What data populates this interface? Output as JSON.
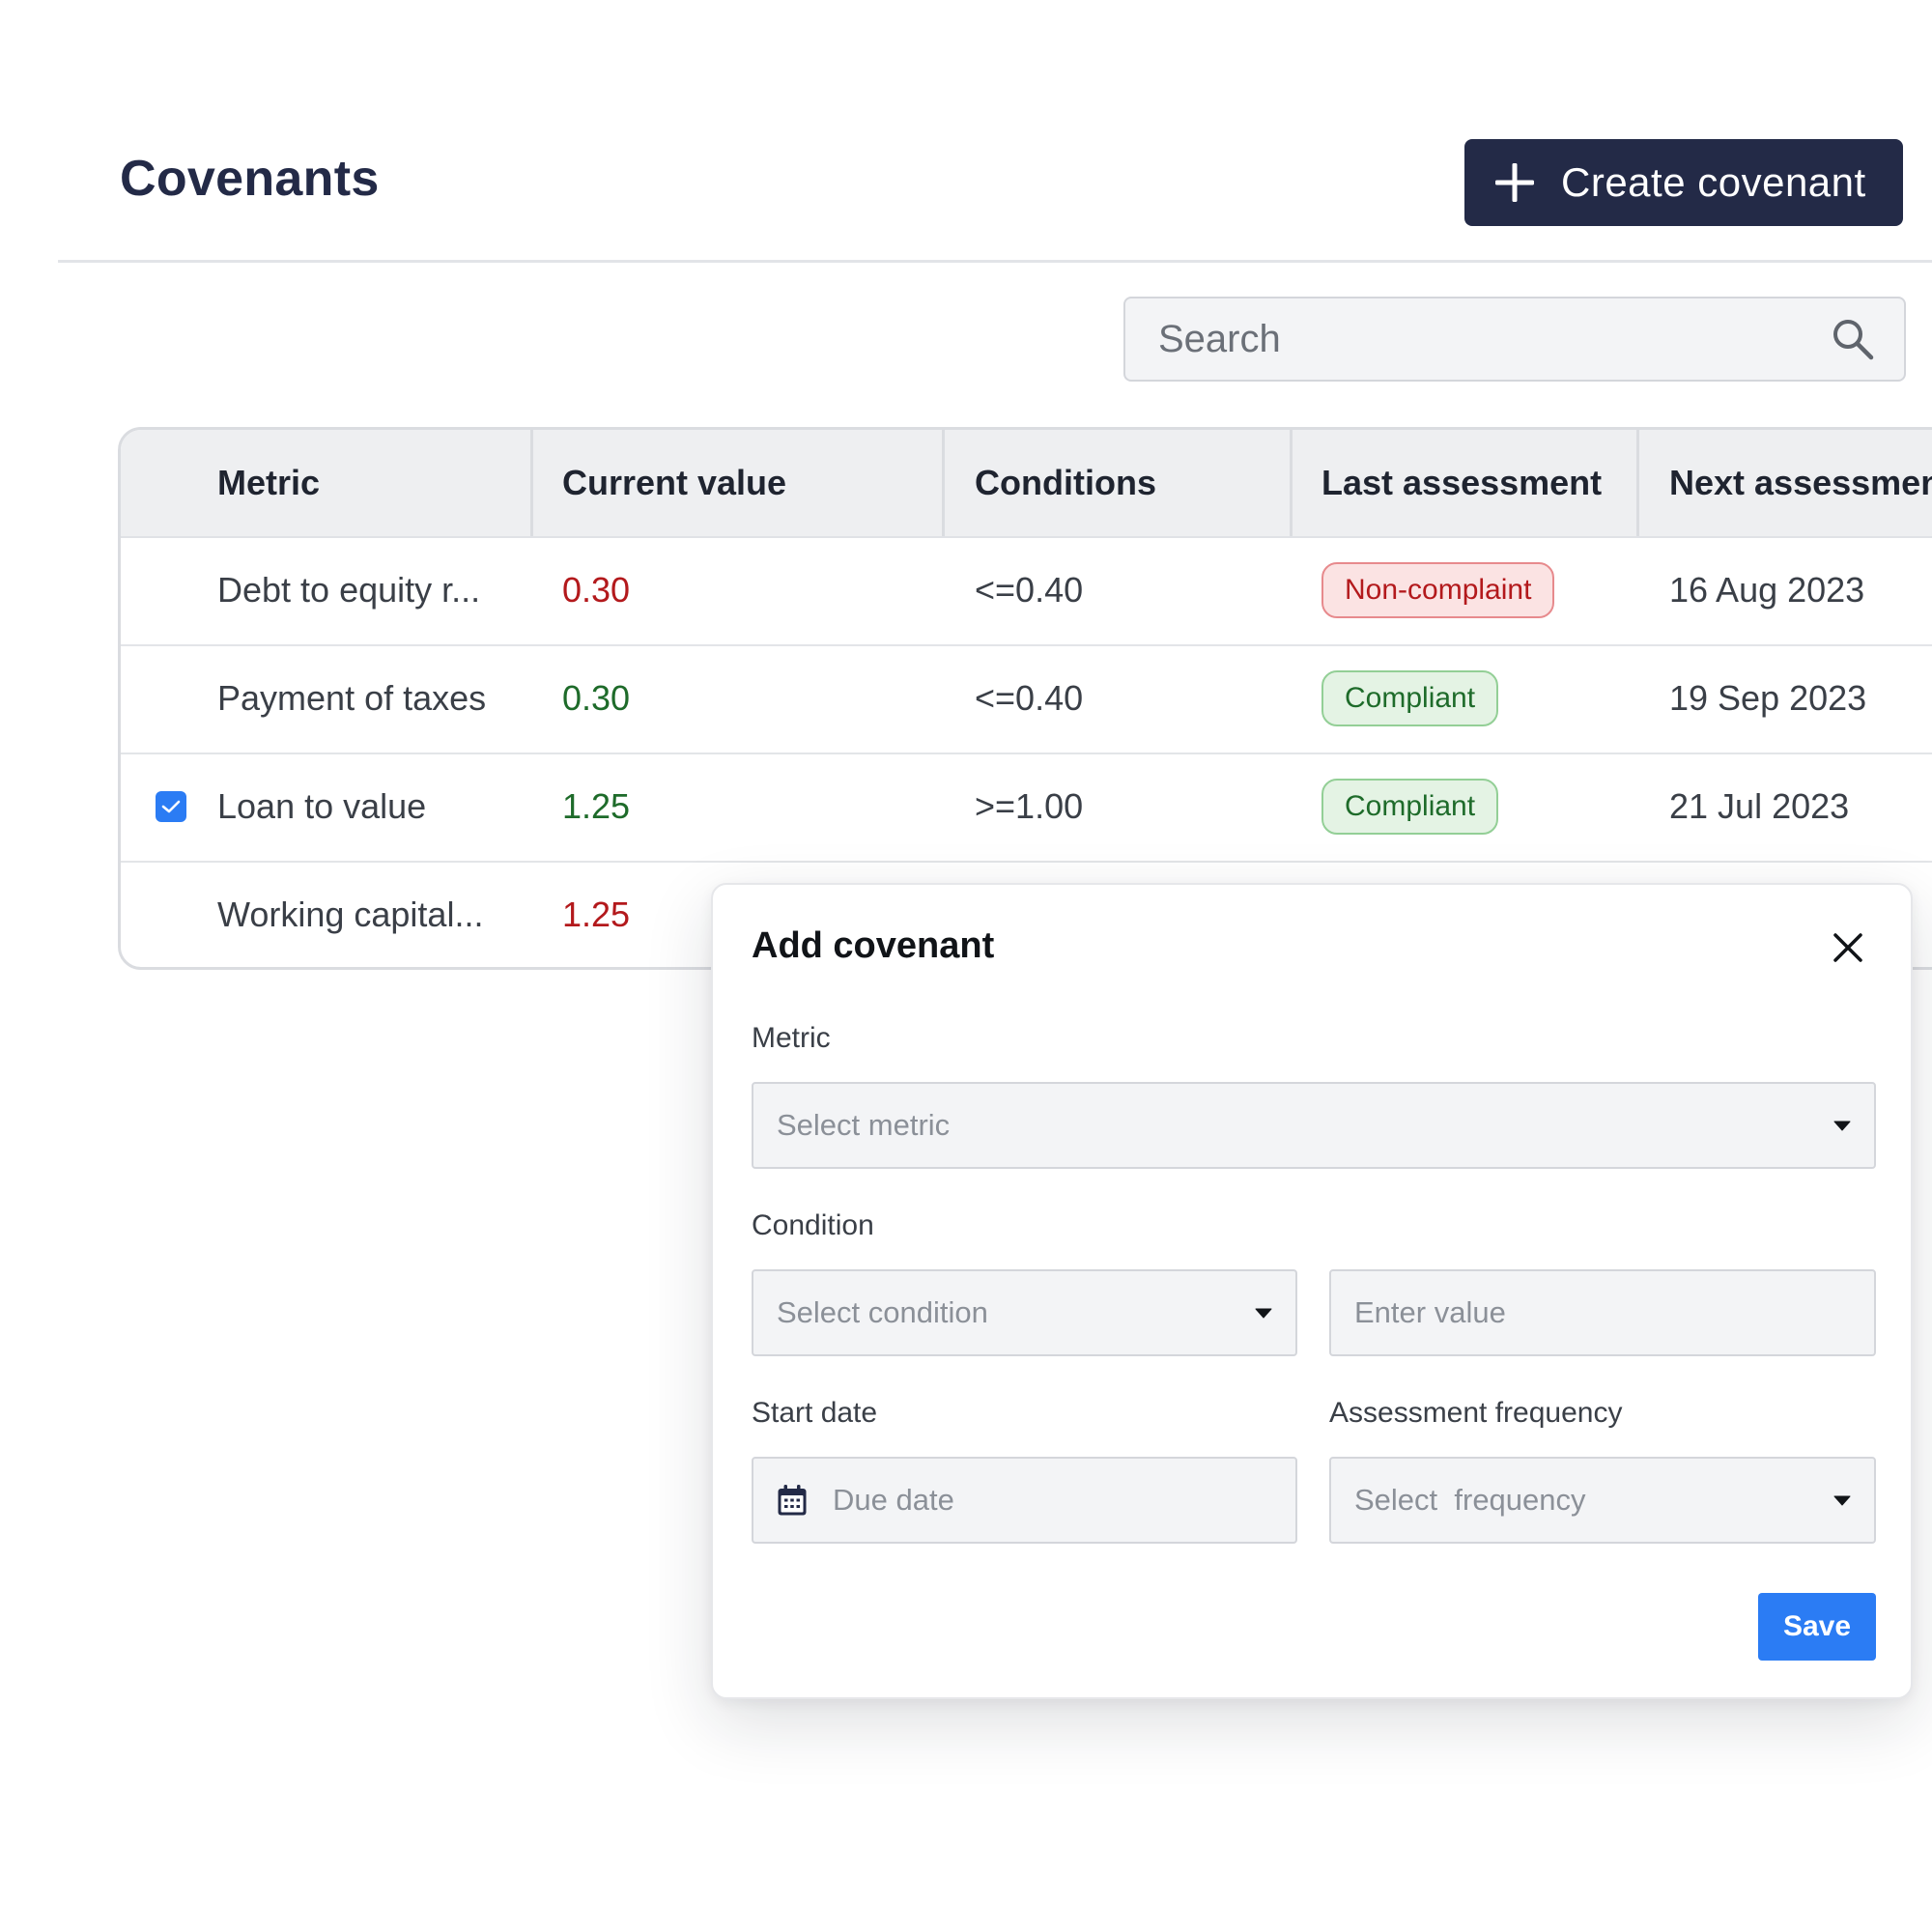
{
  "header": {
    "title": "Covenants",
    "create_label": "Create covenant"
  },
  "search": {
    "placeholder": "Search"
  },
  "table": {
    "columns": [
      "Metric",
      "Current value",
      "Conditions",
      "Last assessment",
      "Next assessmen"
    ],
    "rows": [
      {
        "metric": "Debt to equity r...",
        "value": "0.30",
        "value_status": "red",
        "condition": "<=0.40",
        "assessment": "Non-complaint",
        "assessment_status": "noncompliant",
        "next": "16 Aug 2023",
        "checked": false
      },
      {
        "metric": "Payment of taxes",
        "value": "0.30",
        "value_status": "green",
        "condition": "<=0.40",
        "assessment": "Compliant",
        "assessment_status": "compliant",
        "next": "19 Sep 2023",
        "checked": false
      },
      {
        "metric": "Loan to value",
        "value": "1.25",
        "value_status": "green",
        "condition": ">=1.00",
        "assessment": "Compliant",
        "assessment_status": "compliant",
        "next": "21 Jul 2023",
        "checked": true
      },
      {
        "metric": "Working capital...",
        "value": "1.25",
        "value_status": "red",
        "condition": "",
        "assessment": "",
        "assessment_status": "",
        "next": "",
        "checked": false
      }
    ]
  },
  "modal": {
    "title": "Add covenant",
    "metric_label": "Metric",
    "metric_placeholder": "Select metric",
    "condition_label": "Condition",
    "condition_placeholder": "Select condition",
    "value_placeholder": "Enter value",
    "start_date_label": "Start date",
    "start_date_placeholder": "Due date",
    "frequency_label": "Assessment frequency",
    "frequency_placeholder": "Select  frequency",
    "save_label": "Save"
  },
  "icons": {
    "plus": "plus-icon",
    "search": "search-icon",
    "close": "close-icon",
    "caret": "caret-down-icon",
    "calendar": "calendar-icon",
    "check": "check-icon"
  },
  "colors": {
    "primary_dark": "#232a47",
    "accent_blue": "#2b7cf4",
    "status_red": "#b3191c",
    "status_green": "#1e6b2a"
  }
}
